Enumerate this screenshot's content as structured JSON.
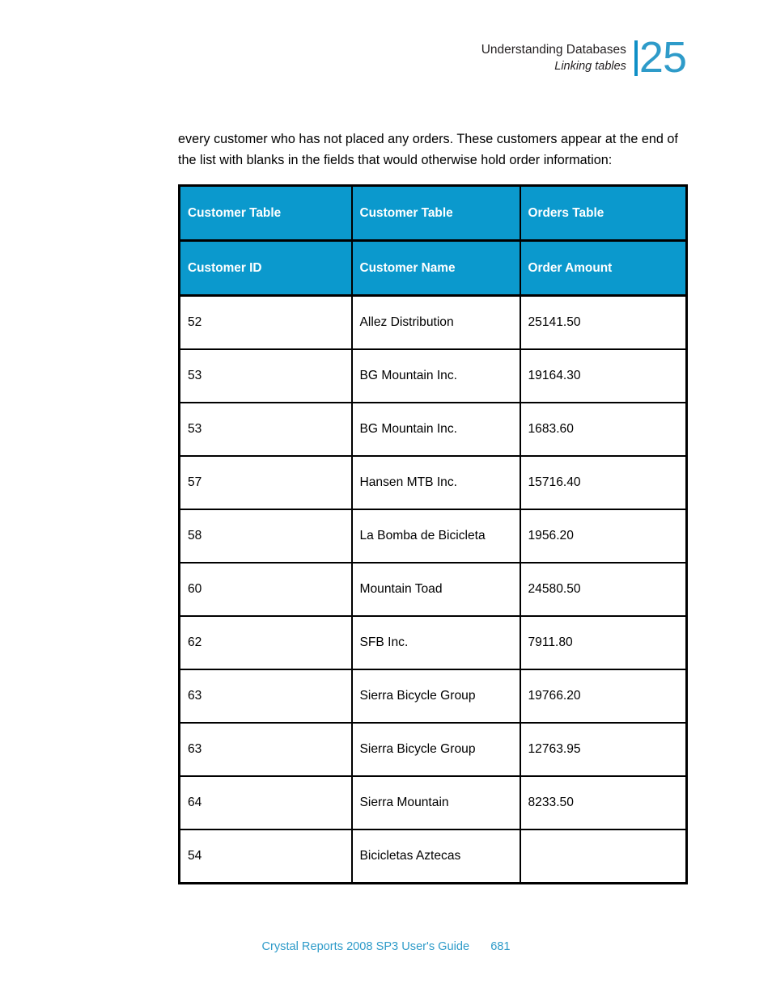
{
  "header": {
    "section_title": "Understanding Databases",
    "subsection_title": "Linking tables",
    "chapter_number": "25",
    "accent_color": "#2e9bc9"
  },
  "body": {
    "paragraph": "every customer who has not placed any orders. These customers appear at the end of the list with blanks in the fields that would otherwise hold order information:"
  },
  "table": {
    "source_headers": [
      "Customer Table",
      "Customer Table",
      "Orders Table"
    ],
    "column_headers": [
      "Customer ID",
      "Customer Name",
      "Order Amount"
    ],
    "header_background": "#0b99cd",
    "header_text_color": "#ffffff",
    "rows": [
      {
        "customer_id": "52",
        "customer_name": "Allez Distribution",
        "order_amount": "25141.50"
      },
      {
        "customer_id": "53",
        "customer_name": "BG Mountain Inc.",
        "order_amount": "19164.30"
      },
      {
        "customer_id": "53",
        "customer_name": "BG Mountain Inc.",
        "order_amount": "1683.60"
      },
      {
        "customer_id": "57",
        "customer_name": "Hansen MTB Inc.",
        "order_amount": "15716.40"
      },
      {
        "customer_id": "58",
        "customer_name": "La Bomba de Bicicleta",
        "order_amount": "1956.20"
      },
      {
        "customer_id": "60",
        "customer_name": "Mountain Toad",
        "order_amount": "24580.50"
      },
      {
        "customer_id": "62",
        "customer_name": "SFB Inc.",
        "order_amount": "7911.80"
      },
      {
        "customer_id": "63",
        "customer_name": "Sierra Bicycle Group",
        "order_amount": "19766.20"
      },
      {
        "customer_id": "63",
        "customer_name": "Sierra Bicycle Group",
        "order_amount": "12763.95"
      },
      {
        "customer_id": "64",
        "customer_name": "Sierra Mountain",
        "order_amount": "8233.50"
      },
      {
        "customer_id": "54",
        "customer_name": "Bicicletas Aztecas",
        "order_amount": ""
      }
    ]
  },
  "footer": {
    "title": "Crystal Reports 2008 SP3 User's Guide",
    "page_number": "681"
  }
}
